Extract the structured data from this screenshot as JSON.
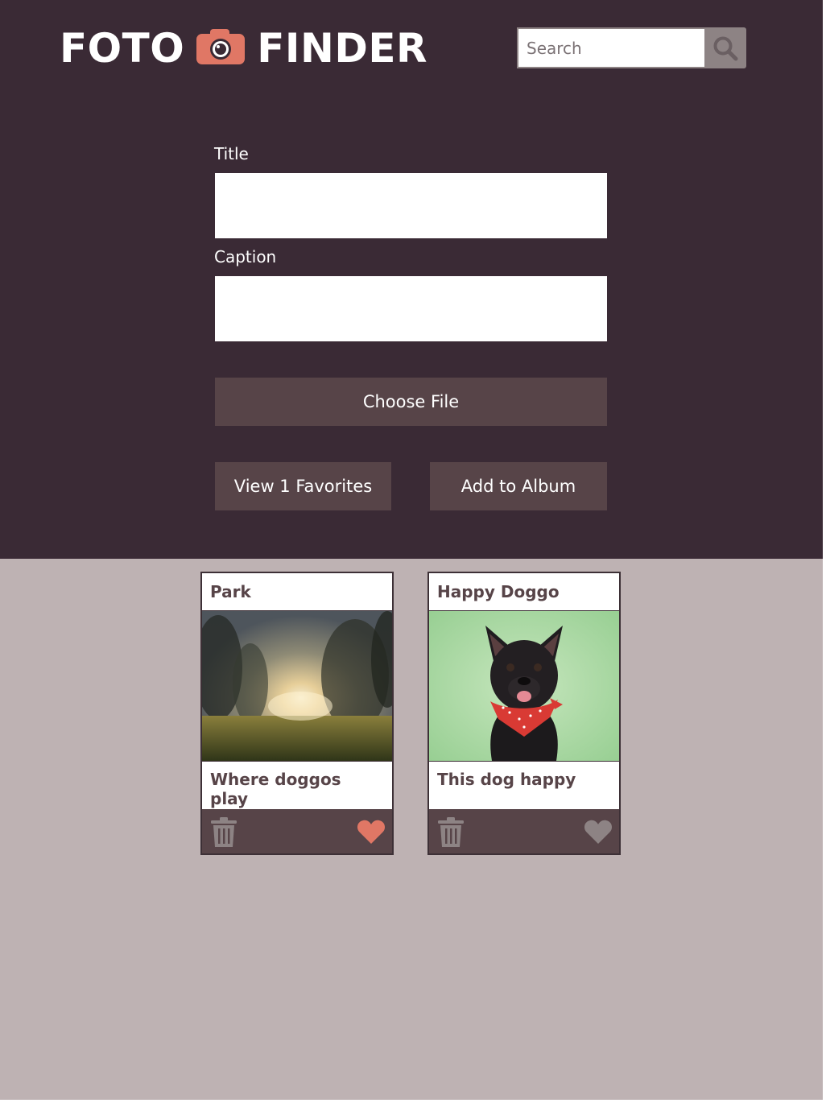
{
  "header": {
    "logo_left": "FOTO",
    "logo_right": "FINDER",
    "logo_icon": "camera-icon",
    "search_placeholder": "Search",
    "search_icon": "magnifier-icon"
  },
  "form": {
    "title_label": "Title",
    "title_value": "",
    "caption_label": "Caption",
    "caption_value": "",
    "choose_file_label": "Choose File",
    "view_favorites_label": "View 1 Favorites",
    "add_album_label": "Add to Album"
  },
  "cards": [
    {
      "title": "Park",
      "caption": "Where doggos play",
      "favorited": true,
      "photo": "sunset-park-photo"
    },
    {
      "title": "Happy Doggo",
      "caption": "This dog happy",
      "favorited": false,
      "photo": "black-dog-bandana-photo"
    }
  ],
  "colors": {
    "header_bg": "#3a2a35",
    "page_bg": "#beb2b3",
    "button_bg": "#574448",
    "accent": "#e07765",
    "icon_gray": "#8d8384"
  }
}
